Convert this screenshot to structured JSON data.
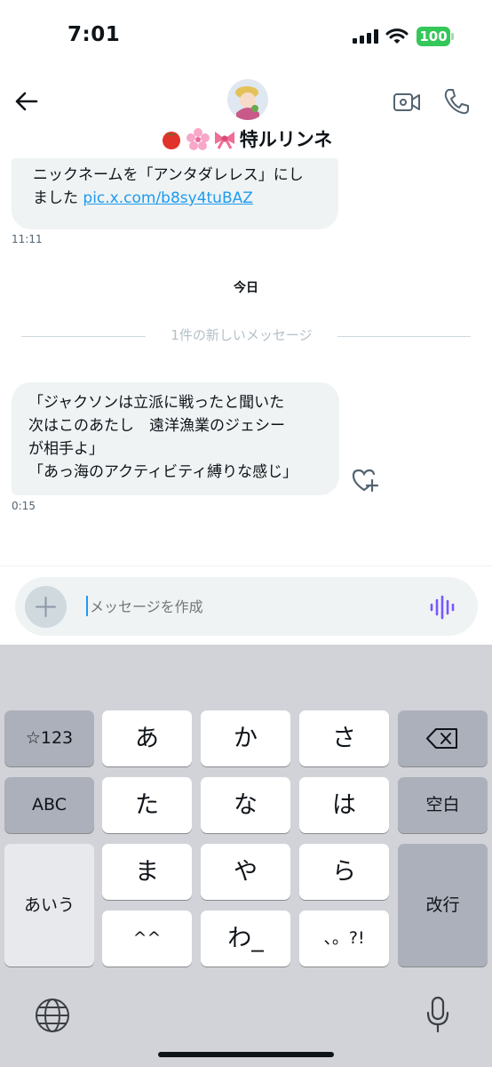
{
  "status_bar": {
    "time": "7:01",
    "battery": "100"
  },
  "header": {
    "name": "🍅🌸🎀特ルリンネ",
    "name_text": "特ルリンネ"
  },
  "messages": [
    {
      "line1": "ニックネームを「アンタダレレス」にし",
      "line2_prefix": "ました ",
      "link": "pic.x.com/b8sy4tuBAZ",
      "time": "11:11"
    },
    {
      "text": "「ジャクソンは立派に戦ったと聞いた\n次はこのあたし　遠洋漁業のジェシー\nが相手よ」\n「あっ海のアクティビティ縛りな感じ」",
      "time": "0:15"
    }
  ],
  "date_separator": "今日",
  "new_messages_label": "1件の新しいメッセージ",
  "composer": {
    "placeholder": "メッセージを作成",
    "value": ""
  },
  "keyboard": {
    "keys": {
      "sym": "☆123",
      "a": "あ",
      "ka": "か",
      "sa": "さ",
      "abc": "ABC",
      "ta": "た",
      "na": "な",
      "ha": "は",
      "space": "空白",
      "kana": "あいう",
      "ma": "ま",
      "ya": "や",
      "ra": "ら",
      "enter": "改行",
      "caret": "^^",
      "wa": "わ_",
      "punct": "、。?!"
    }
  },
  "colors": {
    "accent": "#1d9bf0",
    "bubble": "#eff3f4",
    "battery": "#34c759",
    "voice": "#7856ff"
  }
}
